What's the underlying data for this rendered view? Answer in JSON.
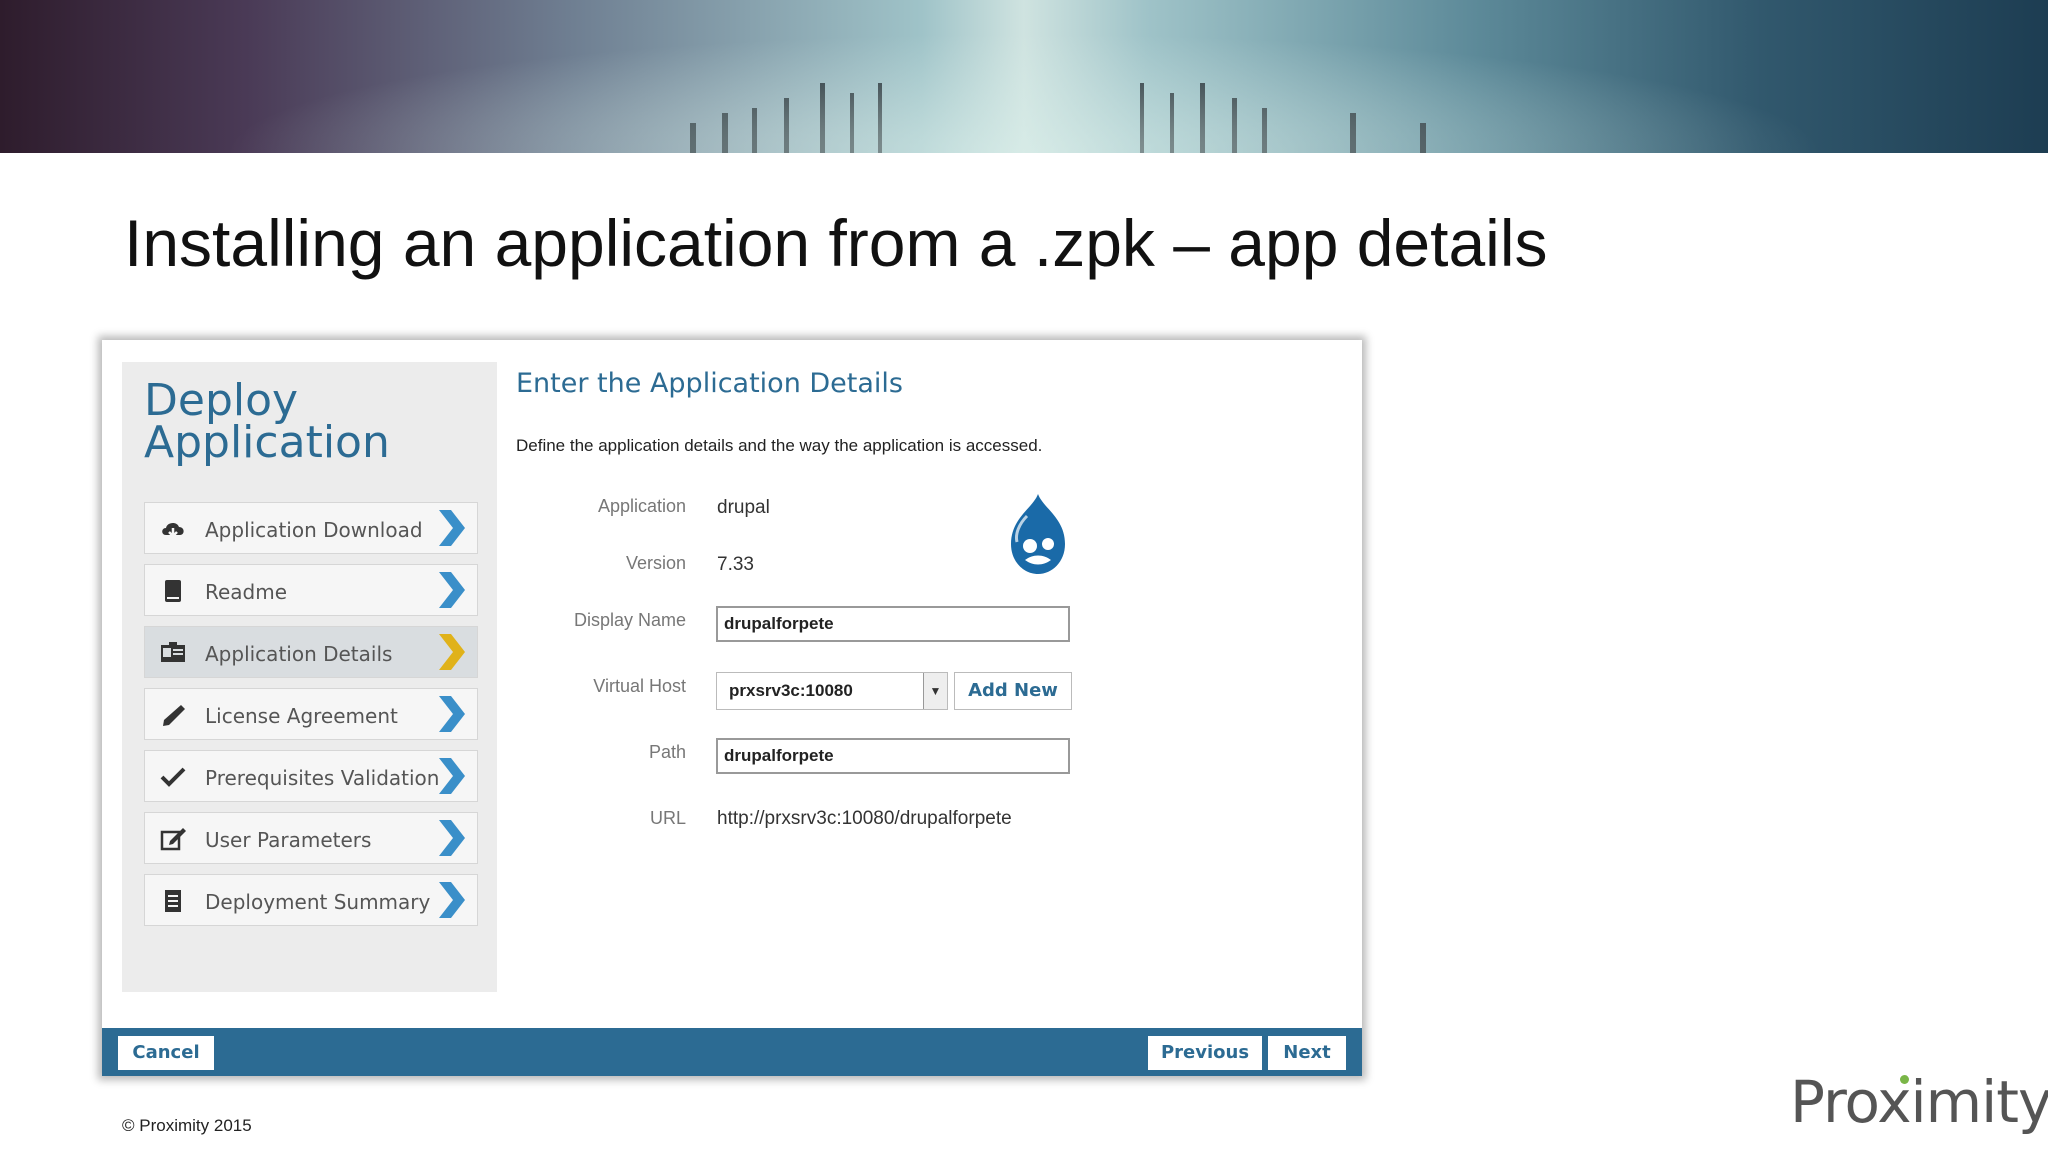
{
  "slide": {
    "title": "Installing an application from a .zpk – app details",
    "copyright": "© Proximity 2015",
    "logo_text": "Proximity"
  },
  "wizard": {
    "heading_line1": "Deploy",
    "heading_line2": "Application",
    "steps": [
      {
        "label": "Application Download",
        "icon": "cloud-download-icon",
        "active": false
      },
      {
        "label": "Readme",
        "icon": "book-icon",
        "active": false
      },
      {
        "label": "Application Details",
        "icon": "id-card-icon",
        "active": true
      },
      {
        "label": "License Agreement",
        "icon": "pen-icon",
        "active": false
      },
      {
        "label": "Prerequisites Validation",
        "icon": "checkmark-icon",
        "active": false
      },
      {
        "label": "User Parameters",
        "icon": "edit-icon",
        "active": false
      },
      {
        "label": "Deployment Summary",
        "icon": "list-icon",
        "active": false
      }
    ]
  },
  "content": {
    "title": "Enter the Application Details",
    "description": "Define the application details and the way the application is accessed.",
    "fields": {
      "application_label": "Application",
      "application_value": "drupal",
      "version_label": "Version",
      "version_value": "7.33",
      "display_name_label": "Display Name",
      "display_name_value": "drupalforpete",
      "virtual_host_label": "Virtual Host",
      "virtual_host_value": "prxsrv3c:10080",
      "add_new_label": "Add New",
      "path_label": "Path",
      "path_value": "drupalforpete",
      "url_label": "URL",
      "url_value": "http://prxsrv3c:10080/drupalforpete"
    }
  },
  "footer": {
    "cancel_label": "Cancel",
    "previous_label": "Previous",
    "next_label": "Next"
  },
  "colors": {
    "accent": "#2c6b93",
    "active_chevron": "#e0b21a",
    "chevron": "#3a8fc9"
  }
}
